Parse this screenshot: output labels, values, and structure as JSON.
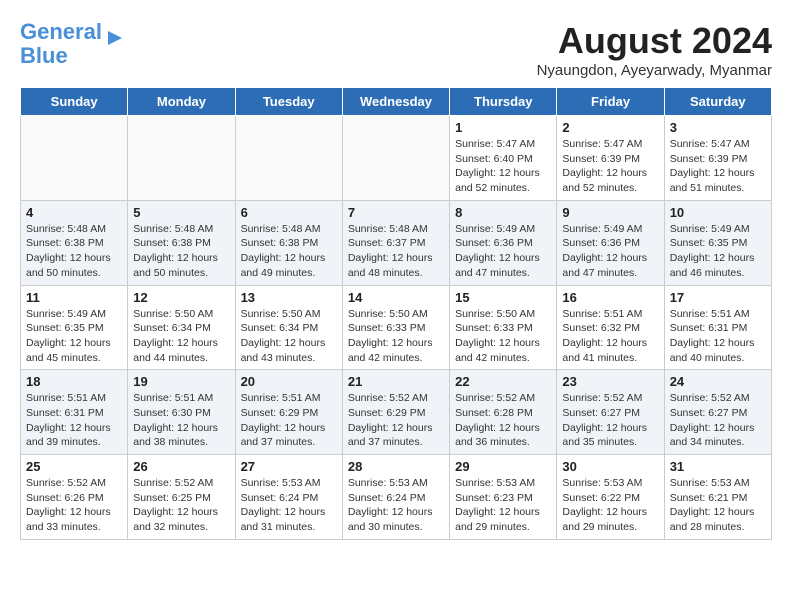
{
  "header": {
    "logo_line1": "General",
    "logo_line2": "Blue",
    "month_title": "August 2024",
    "location": "Nyaungdon, Ayeyarwady, Myanmar"
  },
  "days_of_week": [
    "Sunday",
    "Monday",
    "Tuesday",
    "Wednesday",
    "Thursday",
    "Friday",
    "Saturday"
  ],
  "weeks": [
    [
      {
        "day": "",
        "info": ""
      },
      {
        "day": "",
        "info": ""
      },
      {
        "day": "",
        "info": ""
      },
      {
        "day": "",
        "info": ""
      },
      {
        "day": "1",
        "info": "Sunrise: 5:47 AM\nSunset: 6:40 PM\nDaylight: 12 hours\nand 52 minutes."
      },
      {
        "day": "2",
        "info": "Sunrise: 5:47 AM\nSunset: 6:39 PM\nDaylight: 12 hours\nand 52 minutes."
      },
      {
        "day": "3",
        "info": "Sunrise: 5:47 AM\nSunset: 6:39 PM\nDaylight: 12 hours\nand 51 minutes."
      }
    ],
    [
      {
        "day": "4",
        "info": "Sunrise: 5:48 AM\nSunset: 6:38 PM\nDaylight: 12 hours\nand 50 minutes."
      },
      {
        "day": "5",
        "info": "Sunrise: 5:48 AM\nSunset: 6:38 PM\nDaylight: 12 hours\nand 50 minutes."
      },
      {
        "day": "6",
        "info": "Sunrise: 5:48 AM\nSunset: 6:38 PM\nDaylight: 12 hours\nand 49 minutes."
      },
      {
        "day": "7",
        "info": "Sunrise: 5:48 AM\nSunset: 6:37 PM\nDaylight: 12 hours\nand 48 minutes."
      },
      {
        "day": "8",
        "info": "Sunrise: 5:49 AM\nSunset: 6:36 PM\nDaylight: 12 hours\nand 47 minutes."
      },
      {
        "day": "9",
        "info": "Sunrise: 5:49 AM\nSunset: 6:36 PM\nDaylight: 12 hours\nand 47 minutes."
      },
      {
        "day": "10",
        "info": "Sunrise: 5:49 AM\nSunset: 6:35 PM\nDaylight: 12 hours\nand 46 minutes."
      }
    ],
    [
      {
        "day": "11",
        "info": "Sunrise: 5:49 AM\nSunset: 6:35 PM\nDaylight: 12 hours\nand 45 minutes."
      },
      {
        "day": "12",
        "info": "Sunrise: 5:50 AM\nSunset: 6:34 PM\nDaylight: 12 hours\nand 44 minutes."
      },
      {
        "day": "13",
        "info": "Sunrise: 5:50 AM\nSunset: 6:34 PM\nDaylight: 12 hours\nand 43 minutes."
      },
      {
        "day": "14",
        "info": "Sunrise: 5:50 AM\nSunset: 6:33 PM\nDaylight: 12 hours\nand 42 minutes."
      },
      {
        "day": "15",
        "info": "Sunrise: 5:50 AM\nSunset: 6:33 PM\nDaylight: 12 hours\nand 42 minutes."
      },
      {
        "day": "16",
        "info": "Sunrise: 5:51 AM\nSunset: 6:32 PM\nDaylight: 12 hours\nand 41 minutes."
      },
      {
        "day": "17",
        "info": "Sunrise: 5:51 AM\nSunset: 6:31 PM\nDaylight: 12 hours\nand 40 minutes."
      }
    ],
    [
      {
        "day": "18",
        "info": "Sunrise: 5:51 AM\nSunset: 6:31 PM\nDaylight: 12 hours\nand 39 minutes."
      },
      {
        "day": "19",
        "info": "Sunrise: 5:51 AM\nSunset: 6:30 PM\nDaylight: 12 hours\nand 38 minutes."
      },
      {
        "day": "20",
        "info": "Sunrise: 5:51 AM\nSunset: 6:29 PM\nDaylight: 12 hours\nand 37 minutes."
      },
      {
        "day": "21",
        "info": "Sunrise: 5:52 AM\nSunset: 6:29 PM\nDaylight: 12 hours\nand 37 minutes."
      },
      {
        "day": "22",
        "info": "Sunrise: 5:52 AM\nSunset: 6:28 PM\nDaylight: 12 hours\nand 36 minutes."
      },
      {
        "day": "23",
        "info": "Sunrise: 5:52 AM\nSunset: 6:27 PM\nDaylight: 12 hours\nand 35 minutes."
      },
      {
        "day": "24",
        "info": "Sunrise: 5:52 AM\nSunset: 6:27 PM\nDaylight: 12 hours\nand 34 minutes."
      }
    ],
    [
      {
        "day": "25",
        "info": "Sunrise: 5:52 AM\nSunset: 6:26 PM\nDaylight: 12 hours\nand 33 minutes."
      },
      {
        "day": "26",
        "info": "Sunrise: 5:52 AM\nSunset: 6:25 PM\nDaylight: 12 hours\nand 32 minutes."
      },
      {
        "day": "27",
        "info": "Sunrise: 5:53 AM\nSunset: 6:24 PM\nDaylight: 12 hours\nand 31 minutes."
      },
      {
        "day": "28",
        "info": "Sunrise: 5:53 AM\nSunset: 6:24 PM\nDaylight: 12 hours\nand 30 minutes."
      },
      {
        "day": "29",
        "info": "Sunrise: 5:53 AM\nSunset: 6:23 PM\nDaylight: 12 hours\nand 29 minutes."
      },
      {
        "day": "30",
        "info": "Sunrise: 5:53 AM\nSunset: 6:22 PM\nDaylight: 12 hours\nand 29 minutes."
      },
      {
        "day": "31",
        "info": "Sunrise: 5:53 AM\nSunset: 6:21 PM\nDaylight: 12 hours\nand 28 minutes."
      }
    ]
  ]
}
